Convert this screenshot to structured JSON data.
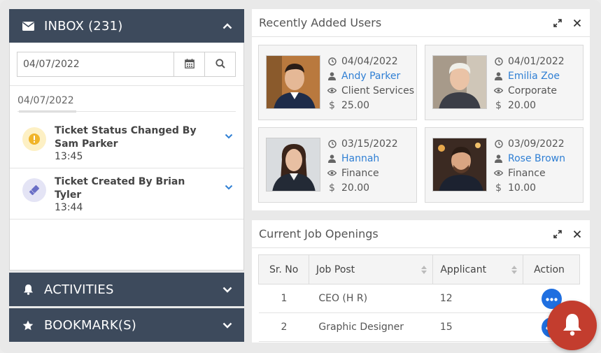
{
  "colors": {
    "accent_dark": "#3d4a5c",
    "link": "#2f7fd4",
    "action": "#1f6fe0",
    "alert": "#c33d2e"
  },
  "inbox": {
    "title": "INBOX (231)",
    "date_value": "04/07/2022",
    "date_group_label": "04/07/2022",
    "tickets": [
      {
        "title": "Ticket Status Changed By Sam Parker",
        "time": "13:45",
        "icon": "warning-icon"
      },
      {
        "title": "Ticket Created By Brian Tyler",
        "time": "13:44",
        "icon": "ticket-icon"
      }
    ]
  },
  "activities": {
    "title": "ACTIVITIES"
  },
  "bookmarks": {
    "title": "BOOKMARK(S)"
  },
  "recent_users": {
    "title": "Recently Added Users",
    "users": [
      {
        "date": "04/04/2022",
        "name": "Andy Parker",
        "department": "Client Services",
        "amount": "25.00"
      },
      {
        "date": "04/01/2022",
        "name": "Emilia Zoe",
        "department": "Corporate",
        "amount": "20.00"
      },
      {
        "date": "03/15/2022",
        "name": "Hannah",
        "department": "Finance",
        "amount": "20.00"
      },
      {
        "date": "03/09/2022",
        "name": "Rose Brown",
        "department": "Finance",
        "amount": "10.00"
      }
    ]
  },
  "jobs": {
    "title": "Current Job Openings",
    "columns": [
      "Sr. No",
      "Job Post",
      "Applicant",
      "Action"
    ],
    "rows": [
      {
        "sr": "1",
        "post": "CEO (H R)",
        "applicants": "12"
      },
      {
        "sr": "2",
        "post": "Graphic Designer",
        "applicants": "15"
      }
    ]
  }
}
